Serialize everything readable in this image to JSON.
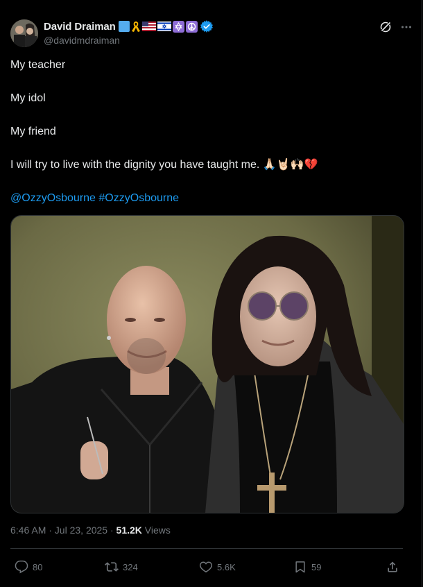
{
  "author": {
    "display_name": "David Draiman",
    "handle": "@davidmdraiman",
    "verified": true,
    "name_emojis": [
      "blue-square",
      "ribbon",
      "us-flag",
      "israel-flag",
      "star-of-david",
      "peace-symbol"
    ]
  },
  "tweet": {
    "lines": [
      "My teacher",
      "My idol",
      "My friend",
      "I will try to live with the dignity you have taught me. 🙏🏻🤘🏻🙌🏻💔"
    ],
    "mentions": "@OzzyOsbourne #OzzyOsbourne"
  },
  "meta": {
    "timestamp": "6:46 AM · Jul 23, 2025 · ",
    "views_count": "51.2K",
    "views_label": " Views"
  },
  "actions": {
    "replies": "80",
    "reposts": "324",
    "likes": "5.6K",
    "bookmarks": "59"
  },
  "colors": {
    "background": "#000000",
    "text": "#e7e9ea",
    "secondary": "#71767b",
    "link": "#1d9bf0",
    "border": "#2f3336"
  }
}
